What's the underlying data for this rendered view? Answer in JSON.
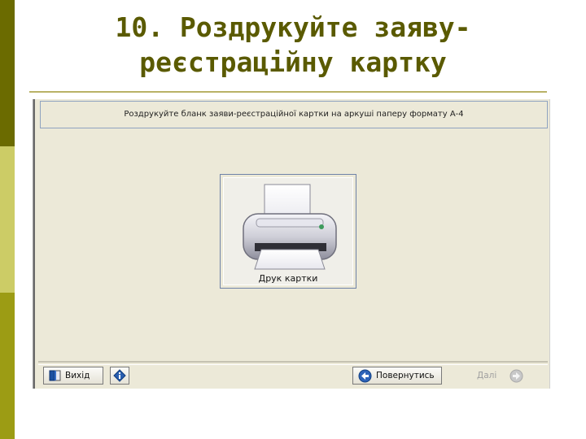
{
  "slide": {
    "title_line1": "10. Роздрукуйте заяву-",
    "title_line2": "реєстраційну картку"
  },
  "app": {
    "instruction": "Роздрукуйте бланк заяви-реєстраційної картки на аркуші паперу формату А-4",
    "print_card_label": "Друк картки",
    "buttons": {
      "exit_label": "Вихід",
      "back_label": "Повернутись",
      "next_label": "Далі"
    },
    "icons": {
      "exit": "exit-door-icon",
      "info": "info-icon",
      "back": "back-arrow-icon",
      "next": "forward-arrow-icon",
      "printer": "printer-icon"
    }
  },
  "colors": {
    "title": "#5a5a00",
    "bar_dark": "#6b6b00",
    "bar_light": "#cccc66",
    "bar_mid": "#9c9c14",
    "window_bg": "#ece9d8"
  }
}
